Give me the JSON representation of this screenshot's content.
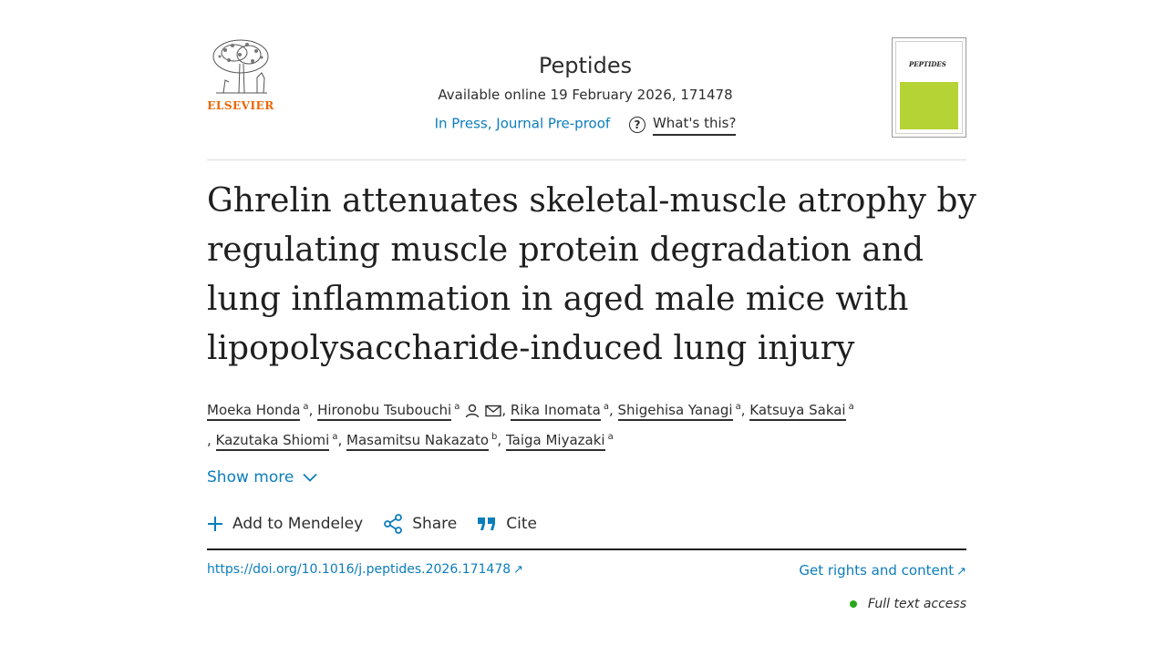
{
  "header": {
    "publisher": "ELSEVIER",
    "journal": "Peptides",
    "availability": "Available online 19 February 2026, 171478",
    "status_link": "In Press, Journal Pre-proof",
    "whats_this": "What's this?",
    "cover_title": "PEPTIDES"
  },
  "article": {
    "title": "Ghrelin attenuates skeletal-muscle atrophy by regulating muscle protein degradation and lung inflammation in aged male mice with lipopolysaccharide-induced lung injury"
  },
  "authors": [
    {
      "name": "Moeka Honda",
      "aff": "a"
    },
    {
      "name": "Hironobu Tsubouchi",
      "aff": "a",
      "icons": [
        "person-icon",
        "mail-icon"
      ]
    },
    {
      "name": "Rika Inomata",
      "aff": "a"
    },
    {
      "name": "Shigehisa Yanagi",
      "aff": "a"
    },
    {
      "name": "Katsuya Sakai",
      "aff": "a"
    },
    {
      "name": "Kazutaka Shiomi",
      "aff": "a"
    },
    {
      "name": "Masamitsu Nakazato",
      "aff": "b"
    },
    {
      "name": "Taiga Miyazaki",
      "aff": "a"
    }
  ],
  "show_more": "Show more",
  "actions": {
    "mendeley": "Add to Mendeley",
    "share": "Share",
    "cite": "Cite"
  },
  "links": {
    "doi": "https://doi.org/10.1016/j.peptides.2026.171478",
    "rights": "Get rights and content",
    "arrow": "↗"
  },
  "access": "Full text access",
  "colors": {
    "link": "#0c7dbb",
    "elsevier_orange": "#eb6500",
    "cover_green": "#b5d335",
    "access_dot": "#29a61b"
  }
}
